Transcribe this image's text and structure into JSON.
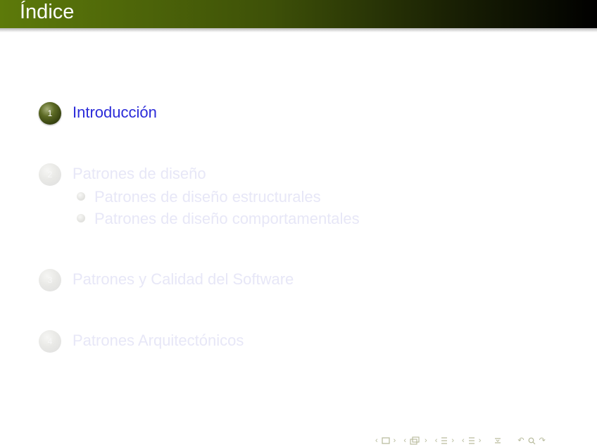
{
  "header": {
    "title": "Índice"
  },
  "toc": {
    "sections": [
      {
        "number": "1",
        "label": "Introducción",
        "state": "active"
      },
      {
        "number": "2",
        "label": "Patrones de diseño",
        "state": "dim",
        "subsections": [
          "Patrones de diseño estructurales",
          "Patrones de diseño comportamentales"
        ]
      },
      {
        "number": "3",
        "label": "Patrones y Calidad del Software",
        "state": "dim"
      },
      {
        "number": "4",
        "label": "Patrones Arquitectónicos",
        "state": "dim"
      }
    ]
  },
  "colors": {
    "header_start": "#5d7a0a",
    "header_end": "#000000",
    "active_text": "#2b2bd9",
    "dim_text": "#e7e7f7"
  },
  "navigation": {
    "icons": [
      "nav-left-arrow",
      "frame-icon",
      "nav-right-arrow",
      "nav-left-arrow",
      "subsection-icon",
      "nav-right-arrow",
      "nav-left-arrow",
      "section-icon",
      "nav-right-arrow",
      "nav-left-arrow",
      "presentation-icon",
      "nav-right-arrow",
      "alignment-icon",
      "back-icon",
      "search-icon",
      "forward-icon"
    ]
  }
}
